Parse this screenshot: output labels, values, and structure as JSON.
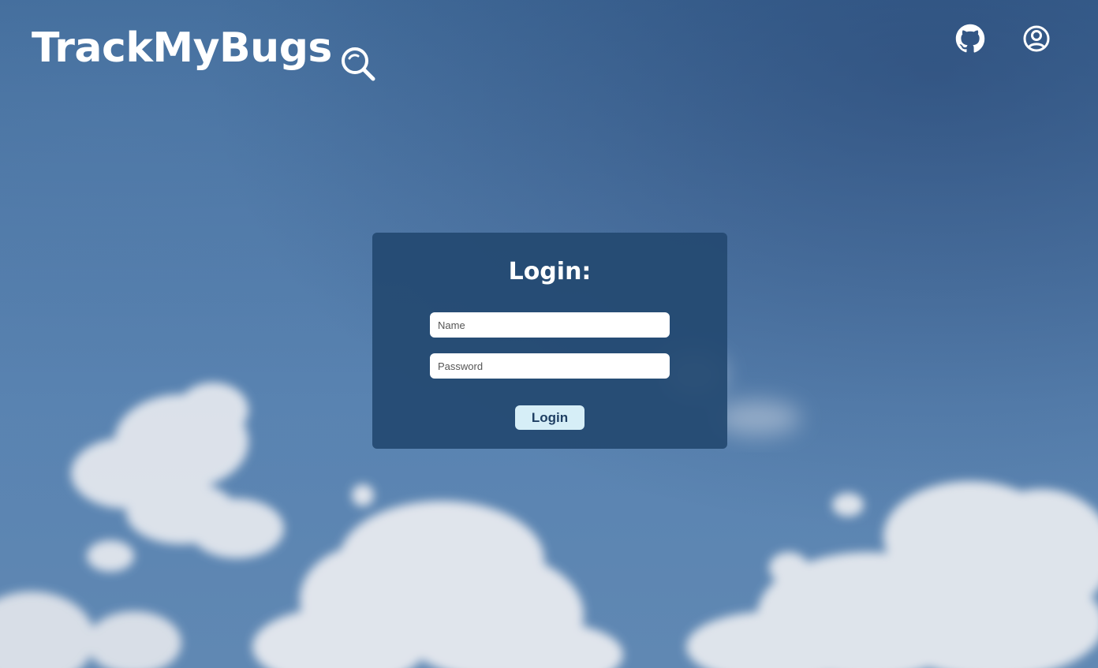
{
  "header": {
    "logo_text": "TrackMyBugs",
    "logo_icon": "magnifier-icon",
    "github_icon": "github-icon",
    "account_icon": "user-circle-icon"
  },
  "login": {
    "title": "Login:",
    "name_placeholder": "Name",
    "password_placeholder": "Password",
    "button_label": "Login"
  },
  "colors": {
    "card_background": "#244971",
    "button_background": "#d6eef7",
    "button_text": "#1f3f63",
    "sky": "#4e78a7"
  }
}
